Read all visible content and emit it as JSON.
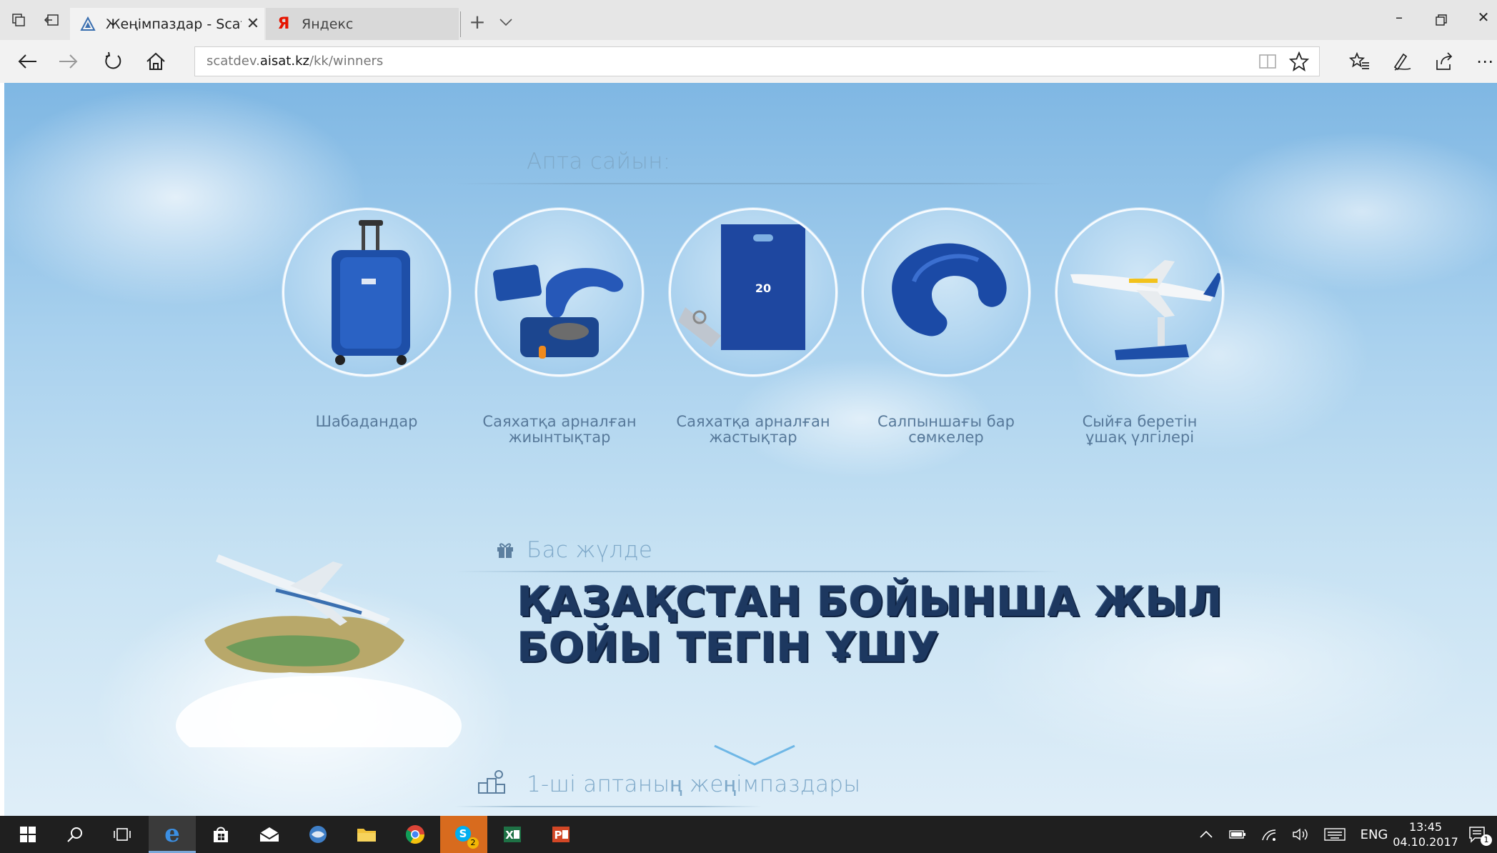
{
  "browser": {
    "tabs": [
      {
        "title": "Жеңімпаздар - Scat",
        "active": true
      },
      {
        "title": "Яндекс",
        "active": false
      }
    ],
    "url_prefix": "scatdev.",
    "url_domain": "aisat.kz",
    "url_path": "/kk/winners",
    "yandex_glyph": "Я"
  },
  "page": {
    "weekly_title": "Апта сайын:",
    "prizes": [
      {
        "label_line1": "Шабадандар",
        "label_line2": "",
        "icon": "suitcase"
      },
      {
        "label_line1": "Саяхатқа арналған",
        "label_line2": "жиынтықтар",
        "icon": "travel-kit"
      },
      {
        "label_line1": "Саяхатқа арналған",
        "label_line2": "жастықтар",
        "icon": "bag-keychain"
      },
      {
        "label_line1": "Салпыншағы бар",
        "label_line2": "сөмкелер",
        "icon": "neck-pillow"
      },
      {
        "label_line1": "Сыйға беретін",
        "label_line2": "ұшақ үлгілері",
        "icon": "airplane-model"
      }
    ],
    "main_prize_title": "Бас жүлде",
    "main_prize_line1": "ҚАЗАҚСТАН БОЙЫНША ЖЫЛ",
    "main_prize_line2": "БОЙЫ ТЕГІН ҰШУ",
    "winners_title": "1-ші аптаның жеңімпаздары"
  },
  "taskbar": {
    "language": "ENG",
    "time": "13:45",
    "date": "04.10.2017",
    "skype_badge": "2",
    "notification_count": "1"
  },
  "colors": {
    "accent_blue": "#1e4fa8",
    "title_text": "#7fa9c9",
    "label_text": "#57799a",
    "main_prize_text": "#1d3860"
  }
}
